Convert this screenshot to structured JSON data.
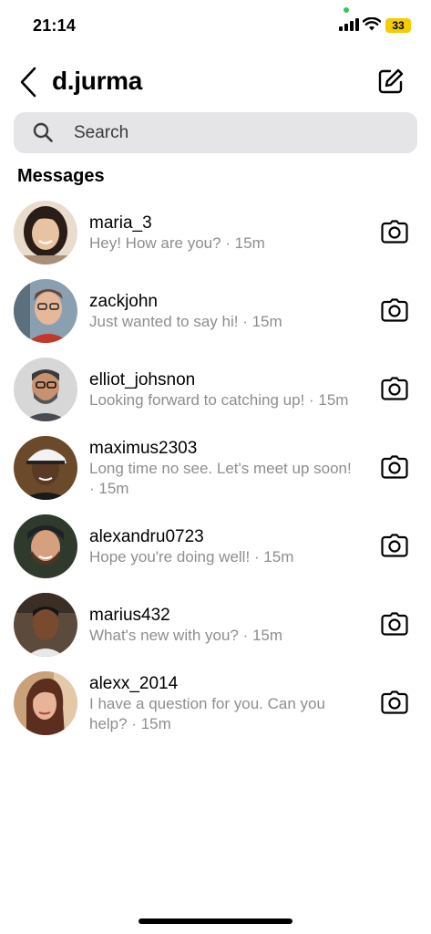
{
  "status_bar": {
    "time": "21:14",
    "battery": "33"
  },
  "header": {
    "title": "d.jurma"
  },
  "search": {
    "placeholder": "Search"
  },
  "section_title": "Messages",
  "conversations": [
    {
      "name": "maria_3",
      "message": "Hey! How are you? · 15m"
    },
    {
      "name": "zackjohn",
      "message": "Just wanted to say hi! · 15m"
    },
    {
      "name": "elliot_johsnon",
      "message": "Looking forward to catching up! · 15m"
    },
    {
      "name": "maximus2303",
      "message": "Long time no see. Let's meet up soon! · 15m"
    },
    {
      "name": "alexandru0723",
      "message": "Hope you're doing well! · 15m"
    },
    {
      "name": "marius432",
      "message": "What's new with you? · 15m"
    },
    {
      "name": "alexx_2014",
      "message": "I have a question for you. Can you help? · 15m"
    }
  ],
  "colors": {
    "battery": "#f5cc00",
    "search_bg": "#e5e5e7",
    "secondary_text": "#8e8e93",
    "mic_dot": "#34c759"
  },
  "icons": {
    "back": "chevron-left-icon",
    "compose": "compose-icon",
    "search": "search-icon",
    "camera": "camera-icon"
  }
}
